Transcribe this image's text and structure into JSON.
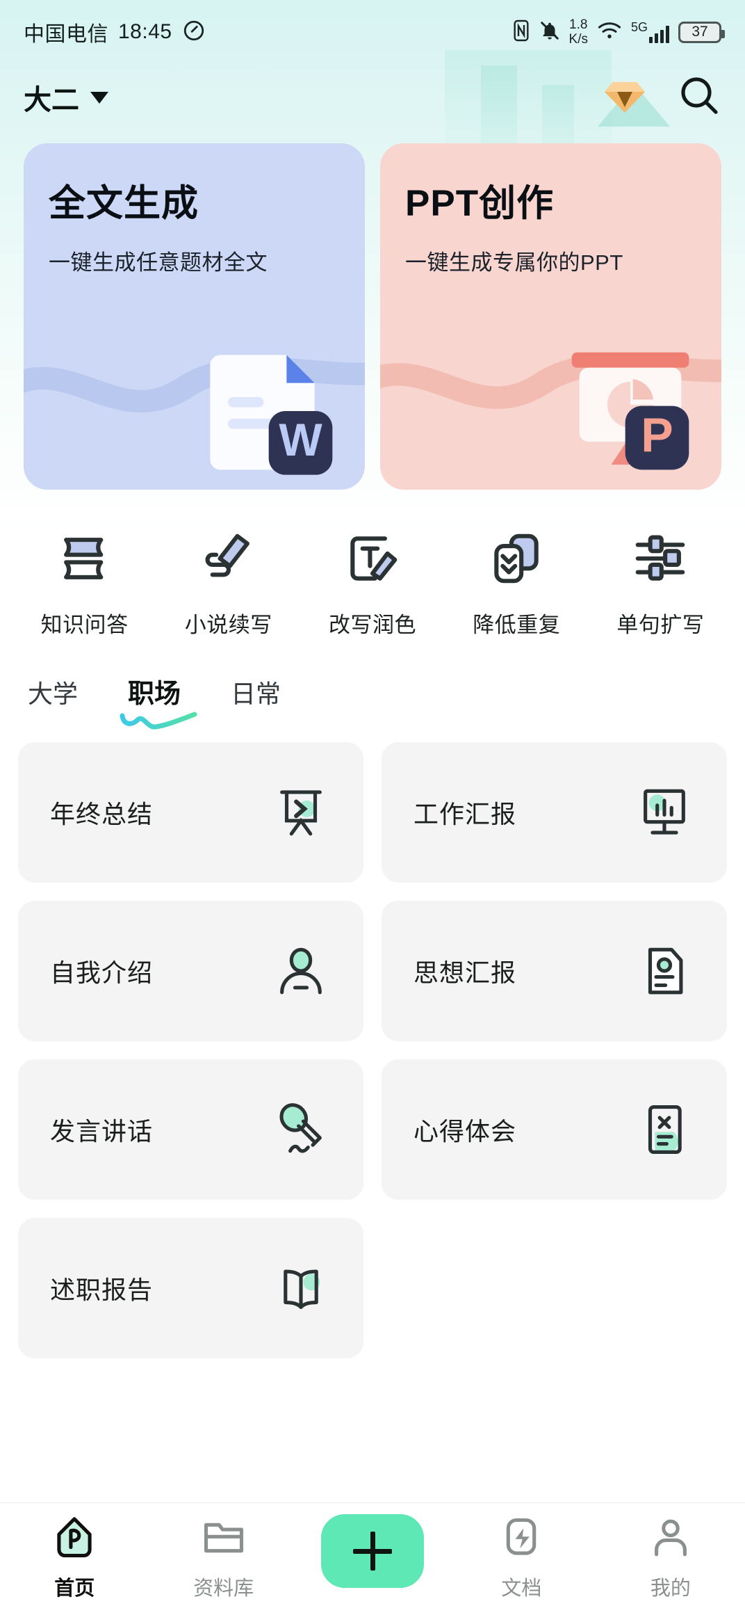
{
  "statusbar": {
    "carrier": "中国电信",
    "time": "18:45",
    "net_speed_value": "1.8",
    "net_speed_unit": "K/s",
    "network_type": "5G",
    "battery_percent": "37",
    "icons": [
      "speed-icon",
      "nfc-icon",
      "mute-bell-icon",
      "wifi-icon",
      "signal-icon",
      "battery-icon"
    ]
  },
  "header": {
    "grade": "大二",
    "vip_icon": "diamond-icon",
    "search_icon": "search-icon"
  },
  "banners": [
    {
      "title": "全文生成",
      "subtitle": "一键生成任意题材全文",
      "bg": "#ccd8f5",
      "art": "word-doc-icon",
      "badge_letter": "W"
    },
    {
      "title": "PPT创作",
      "subtitle": "一键生成专属你的PPT",
      "bg": "#f8d5cf",
      "art": "ppt-board-icon",
      "badge_letter": "P"
    }
  ],
  "quick_actions": [
    {
      "label": "知识问答",
      "icon": "books-icon"
    },
    {
      "label": "小说续写",
      "icon": "pen-write-icon"
    },
    {
      "label": "改写润色",
      "icon": "text-edit-icon"
    },
    {
      "label": "降低重复",
      "icon": "layers-down-icon"
    },
    {
      "label": "单句扩写",
      "icon": "sliders-icon"
    }
  ],
  "tabs": [
    {
      "label": "大学",
      "active": false
    },
    {
      "label": "职场",
      "active": true
    },
    {
      "label": "日常",
      "active": false
    }
  ],
  "grid_cards": [
    {
      "label": "年终总结",
      "icon": "easel-icon"
    },
    {
      "label": "工作汇报",
      "icon": "monitor-chart-icon"
    },
    {
      "label": "自我介绍",
      "icon": "person-icon"
    },
    {
      "label": "思想汇报",
      "icon": "doc-circle-icon"
    },
    {
      "label": "发言讲话",
      "icon": "microphone-icon"
    },
    {
      "label": "心得体会",
      "icon": "doc-x-icon"
    },
    {
      "label": "述职报告",
      "icon": "open-book-icon"
    }
  ],
  "bottom_nav": [
    {
      "label": "首页",
      "icon": "home-leaf-icon",
      "active": true
    },
    {
      "label": "资料库",
      "icon": "folder-icon",
      "active": false
    },
    {
      "label": "",
      "icon": "plus-icon",
      "active": false
    },
    {
      "label": "文档",
      "icon": "lightning-doc-icon",
      "active": false
    },
    {
      "label": "我的",
      "icon": "user-icon",
      "active": false
    }
  ],
  "colors": {
    "accent_green": "#5de8b6",
    "mint": "#a6ecd2",
    "banner_blue": "#ccd8f5",
    "banner_pink": "#f8d5cf",
    "card_gray": "#f4f4f4",
    "navy": "#2c3050"
  }
}
